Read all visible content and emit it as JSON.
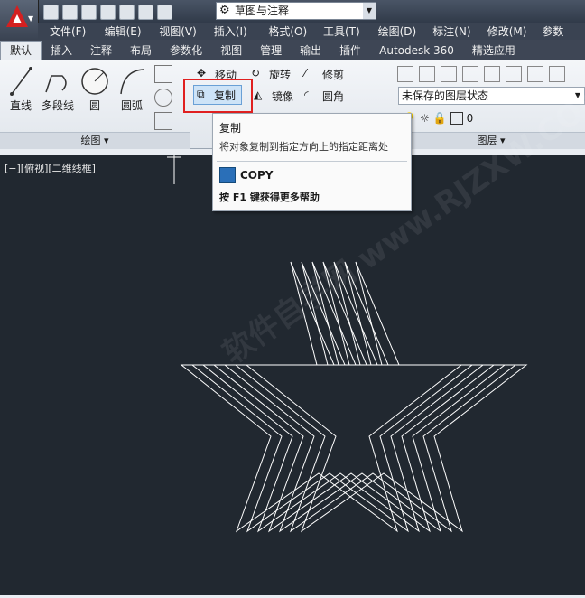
{
  "workspace": {
    "name": "草图与注释"
  },
  "menu": [
    "文件(F)",
    "编辑(E)",
    "视图(V)",
    "插入(I)",
    "格式(O)",
    "工具(T)",
    "绘图(D)",
    "标注(N)",
    "修改(M)",
    "参数"
  ],
  "tabs": [
    "默认",
    "插入",
    "注释",
    "布局",
    "参数化",
    "视图",
    "管理",
    "输出",
    "插件",
    "Autodesk 360",
    "精选应用"
  ],
  "draw_panel": {
    "line": "直线",
    "polyline": "多段线",
    "circle": "圆",
    "arc": "圆弧",
    "title": "绘图"
  },
  "modify_panel": {
    "move": "移动",
    "rotate": "旋转",
    "trim": "修剪",
    "copy": "复制",
    "mirror": "镜像",
    "fillet": "圆角"
  },
  "layer_panel": {
    "state": "未保存的图层状态",
    "current": "0",
    "title": "图层"
  },
  "tooltip": {
    "title": "复制",
    "desc": "将对象复制到指定方向上的指定距离处",
    "command": "COPY",
    "help": "按 F1 键获得更多帮助"
  },
  "viewport": {
    "label": "[−][俯视][二维线框]"
  },
  "watermark": "软件自学网 www.RJZXW.COM",
  "colors": {
    "canvas": "#212830",
    "star_lines": "#ffffff",
    "highlight_box": "#e02020"
  }
}
